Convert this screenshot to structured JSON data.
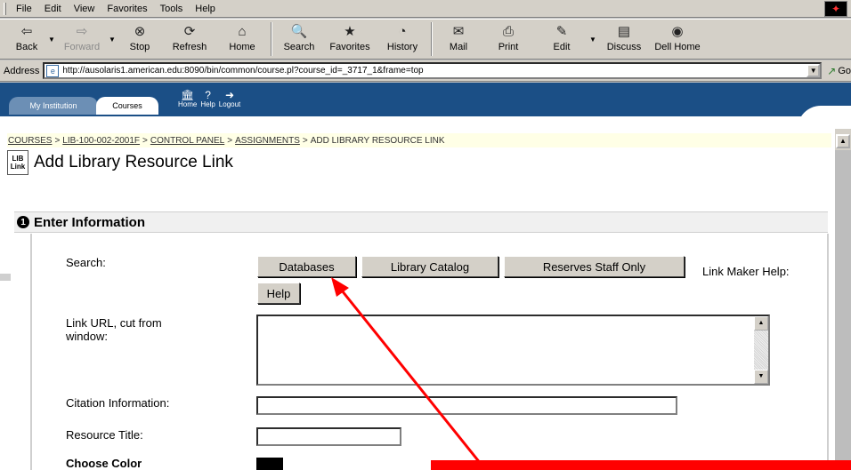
{
  "menu": [
    "File",
    "Edit",
    "View",
    "Favorites",
    "Tools",
    "Help"
  ],
  "toolbar": [
    {
      "label": "Back",
      "icon": "back-arrow-icon",
      "glyph": "⇦",
      "dropdown": true
    },
    {
      "label": "Forward",
      "icon": "forward-arrow-icon",
      "glyph": "⇨",
      "disabled": true,
      "dropdown": true
    },
    {
      "label": "Stop",
      "icon": "stop-icon",
      "glyph": "⊗"
    },
    {
      "label": "Refresh",
      "icon": "refresh-icon",
      "glyph": "⟳"
    },
    {
      "label": "Home",
      "icon": "home-icon",
      "glyph": "⌂"
    },
    {
      "label": "Search",
      "icon": "search-icon",
      "glyph": "🔍"
    },
    {
      "label": "Favorites",
      "icon": "favorites-icon",
      "glyph": "★"
    },
    {
      "label": "History",
      "icon": "history-icon",
      "glyph": "◔"
    },
    {
      "label": "Mail",
      "icon": "mail-icon",
      "glyph": "✉",
      "dropdown": true
    },
    {
      "label": "Print",
      "icon": "print-icon",
      "glyph": "⎙"
    },
    {
      "label": "Edit",
      "icon": "edit-icon",
      "glyph": "✎",
      "dropdown": true
    },
    {
      "label": "Discuss",
      "icon": "discuss-icon",
      "glyph": "▤"
    },
    {
      "label": "Dell Home",
      "icon": "dell-home-icon",
      "glyph": "◉"
    }
  ],
  "address": {
    "label": "Address",
    "url": "http://ausolaris1.american.edu:8090/bin/common/course.pl?course_id=_3717_1&frame=top",
    "go": "Go"
  },
  "header": {
    "tabs": [
      "My Institution",
      "Courses"
    ],
    "icons": [
      {
        "label": "Home",
        "glyph": "🏛"
      },
      {
        "label": "Help",
        "glyph": "?"
      },
      {
        "label": "Logout",
        "glyph": "➜"
      }
    ]
  },
  "breadcrumb": [
    "COURSES",
    "LIB-100-002-2001F",
    "CONTROL PANEL",
    "ASSIGNMENTS",
    "ADD LIBRARY RESOURCE LINK"
  ],
  "page": {
    "icon_text_top": "LIB",
    "icon_text_bottom": "Link",
    "title": "Add Library Resource Link"
  },
  "section": {
    "number": "1",
    "title": "Enter Information"
  },
  "form": {
    "search_label": "Search:",
    "buttons": [
      "Databases",
      "Library Catalog",
      "Reserves Staff Only"
    ],
    "help_label": "Link Maker Help:",
    "help_button": "Help",
    "link_url_label": "Link URL, cut from window:",
    "citation_label": "Citation Information:",
    "title_label": "Resource Title:",
    "color_label": "Choose Color"
  },
  "colors": {
    "header_blue": "#1b4f86",
    "arrow_red": "#ff0000",
    "breadcrumb_bg": "#ffffe6"
  }
}
